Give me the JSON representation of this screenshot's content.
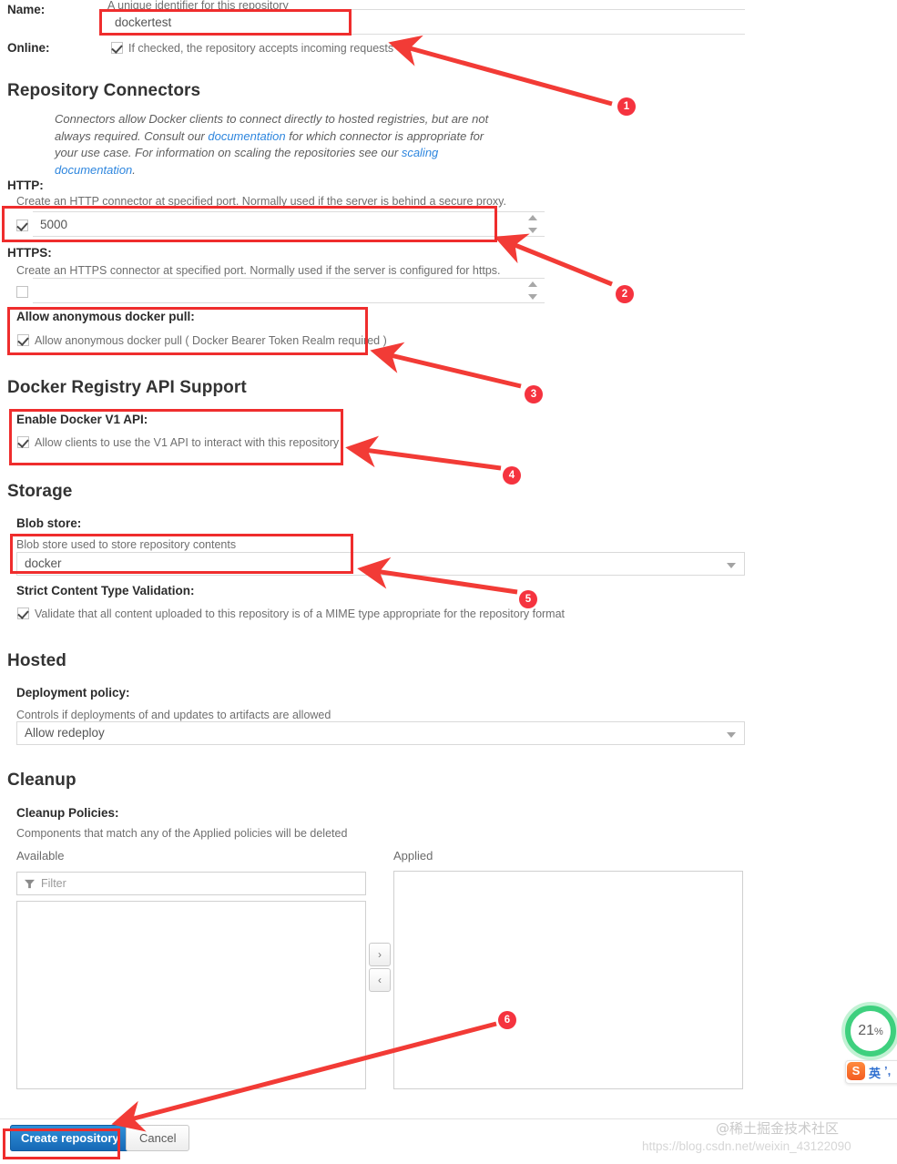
{
  "form": {
    "name": {
      "label": "Name:",
      "helper": "A unique identifier for this repository",
      "value": "dockertest"
    },
    "online": {
      "label": "Online:",
      "checkbox_label": "If checked, the repository accepts incoming requests",
      "checked": true
    }
  },
  "connectors": {
    "title": "Repository Connectors",
    "intro_1": "Connectors allow Docker clients to connect directly to hosted registries, but are not",
    "intro_2a": "always required. Consult our ",
    "intro_link_1": "documentation",
    "intro_2b": " for which connector is appropriate for",
    "intro_3a": "your use case. For information on scaling the repositories see our ",
    "intro_link_2": "scaling",
    "intro_4a": "documentation",
    "intro_4b": ".",
    "http": {
      "label": "HTTP:",
      "helper": "Create an HTTP connector at specified port. Normally used if the server is behind a secure proxy.",
      "checked": true,
      "value": "5000"
    },
    "https": {
      "label": "HTTPS:",
      "helper": "Create an HTTPS connector at specified port. Normally used if the server is configured for https.",
      "checked": false,
      "value": ""
    },
    "anonymous_pull": {
      "label": "Allow anonymous docker pull:",
      "checkbox_label": "Allow anonymous docker pull ( Docker Bearer Token Realm required )",
      "checked": true
    }
  },
  "api_support": {
    "title": "Docker Registry API Support",
    "v1": {
      "label": "Enable Docker V1 API:",
      "checkbox_label": "Allow clients to use the V1 API to interact with this repository",
      "checked": true
    }
  },
  "storage": {
    "title": "Storage",
    "blob_store": {
      "label": "Blob store:",
      "helper": "Blob store used to store repository contents",
      "value": "docker"
    },
    "strict_validation": {
      "label": "Strict Content Type Validation:",
      "checkbox_label": "Validate that all content uploaded to this repository is of a MIME type appropriate for the repository format",
      "checked": true
    }
  },
  "hosted": {
    "title": "Hosted",
    "deployment_policy": {
      "label": "Deployment policy:",
      "helper": "Controls if deployments of and updates to artifacts are allowed",
      "value": "Allow redeploy"
    }
  },
  "cleanup": {
    "title": "Cleanup",
    "policies": {
      "label": "Cleanup Policies:",
      "helper": "Components that match any of the Applied policies will be deleted",
      "available_label": "Available",
      "applied_label": "Applied",
      "filter_placeholder": "Filter",
      "filter_value": "",
      "available_items": [],
      "applied_items": [],
      "move_right_icon": "chevron-right",
      "move_left_icon": "chevron-left"
    }
  },
  "footer": {
    "create_label": "Create repository",
    "cancel_label": "Cancel"
  },
  "annotations": {
    "badges": [
      "1",
      "2",
      "3",
      "4",
      "5",
      "6"
    ],
    "box_color": "#ef2d2d",
    "badge_color": "#f5333f"
  },
  "watermarks": {
    "line1": "@稀土掘金技术社区",
    "line2": "https://blog.csdn.net/weixin_43122090"
  },
  "ime": {
    "percent": "21",
    "percent_sign": "%",
    "logo_text": "S",
    "mode_text": "英",
    "punct_text": "’,",
    "extra_text": "("
  }
}
